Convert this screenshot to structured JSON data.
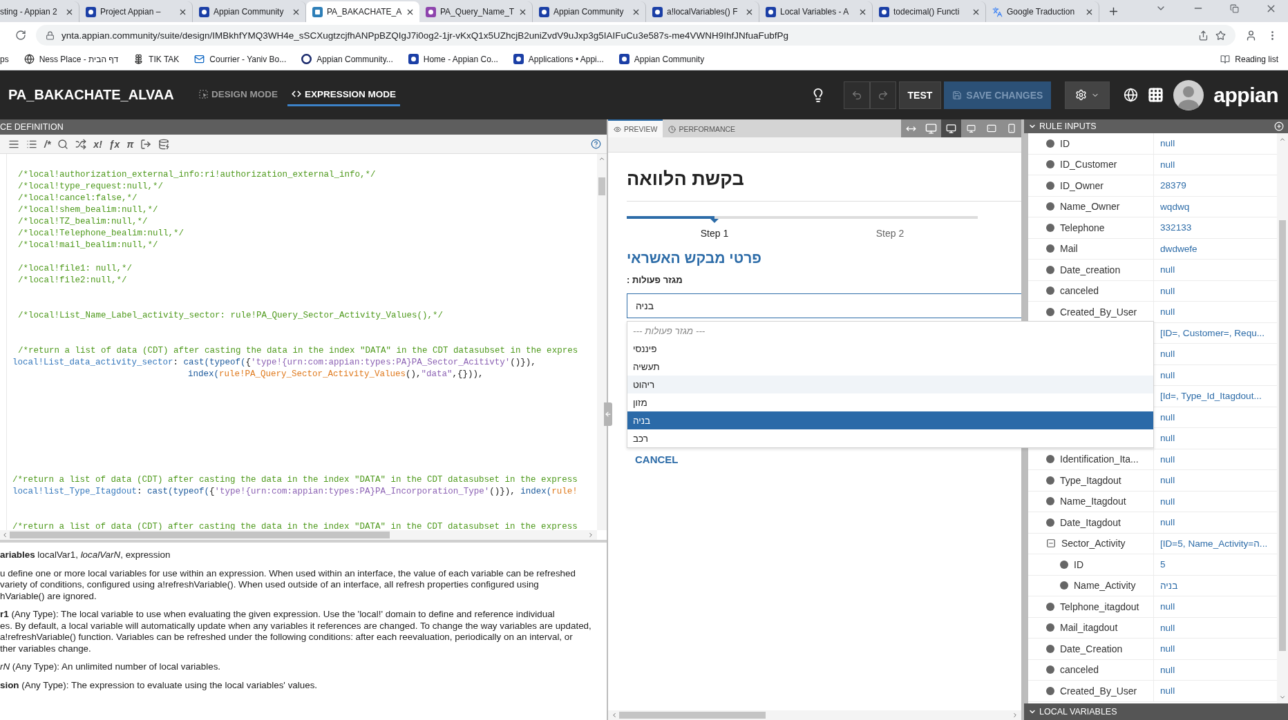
{
  "browser": {
    "tabs": [
      {
        "title": "sting - Appian 2",
        "selected": false
      },
      {
        "title": "Project Appian –",
        "selected": false,
        "kind": "appian"
      },
      {
        "title": "Appian Community",
        "selected": false,
        "kind": "appian"
      },
      {
        "title": "PA_BAKACHATE_A",
        "selected": true,
        "kind": "page"
      },
      {
        "title": "PA_Query_Name_T",
        "selected": false,
        "kind": "query"
      },
      {
        "title": "Appian Community",
        "selected": false,
        "kind": "appian"
      },
      {
        "title": "a!localVariables() F",
        "selected": false,
        "kind": "appian"
      },
      {
        "title": "Local Variables - A",
        "selected": false,
        "kind": "appian"
      },
      {
        "title": "todecimal() Functi",
        "selected": false,
        "kind": "appian"
      },
      {
        "title": "Google Traduction",
        "selected": false,
        "kind": "translate"
      }
    ],
    "url": "ynta.appian.community/suite/design/IMBkhfYMQ3WH4e_sSCXugtzcjfhANPpBZQIgJ7i0og2-1jr-vKxQ1x5UZhcjB2uniZvdV9uJxp3g5IAIFuCu3e587s-me4VWNH9IhfJNfuaFubfPg",
    "bookmarks": [
      {
        "label": "ps"
      },
      {
        "label": "Ness Place - דף הבית",
        "kind": "globe"
      },
      {
        "label": "TIK TAK",
        "kind": "flower"
      },
      {
        "label": "Courrier - Yaniv Bo...",
        "kind": "mail"
      },
      {
        "label": "Appian Community...",
        "kind": "ring"
      },
      {
        "label": "Home - Appian Co...",
        "kind": "appian"
      },
      {
        "label": "Applications • Appi...",
        "kind": "appian"
      },
      {
        "label": "Appian Community",
        "kind": "appian"
      }
    ],
    "reading_list": "Reading list"
  },
  "header": {
    "title": "PA_BAKACHATE_ALVAA",
    "modes": [
      {
        "label": "DESIGN MODE",
        "kind": "design",
        "selected": false
      },
      {
        "label": "EXPRESSION MODE",
        "kind": "expression",
        "selected": true
      }
    ],
    "test": "TEST",
    "save": {
      "label": "SAVE CHANGES",
      "disabled": true
    },
    "logo": "appian"
  },
  "editor": {
    "title": "CE DEFINITION",
    "toolbar": [
      {
        "kind": "indent"
      },
      {
        "kind": "list"
      },
      {
        "kind": "glyph",
        "text": "/*"
      },
      {
        "kind": "search"
      },
      {
        "kind": "shuffle"
      },
      {
        "kind": "glyph",
        "text": "x!"
      },
      {
        "kind": "glyph",
        "text": "ƒx"
      },
      {
        "kind": "glyph",
        "text": "π"
      },
      {
        "kind": "export"
      },
      {
        "kind": "data"
      }
    ],
    "lines": [
      {
        "kind": "comment",
        "tokens": [
          {
            "kind": "comment",
            "t": "/*local!authorization_external_info:ri!authorization_external_info,*/"
          }
        ]
      },
      {
        "kind": "comment",
        "tokens": [
          {
            "kind": "comment",
            "t": "/*local!type_request:null,*/"
          }
        ]
      },
      {
        "kind": "comment",
        "tokens": [
          {
            "kind": "comment",
            "t": "/*local!cancel:false,*/"
          }
        ]
      },
      {
        "kind": "comment",
        "tokens": [
          {
            "kind": "comment",
            "t": "/*local!shem_bealim:null,*/"
          }
        ]
      },
      {
        "kind": "comment",
        "tokens": [
          {
            "kind": "comment",
            "t": "/*local!TZ_bealim:null,*/"
          }
        ]
      },
      {
        "kind": "comment",
        "tokens": [
          {
            "kind": "comment",
            "t": "/*local!Telephone_bealim:null,*/"
          }
        ]
      },
      {
        "kind": "comment",
        "tokens": [
          {
            "kind": "comment",
            "t": "/*local!mail_bealim:null,*/"
          }
        ]
      },
      {
        "kind": "blank"
      },
      {
        "kind": "comment",
        "tokens": [
          {
            "kind": "comment",
            "t": "/*local!file1: null,*/"
          }
        ]
      },
      {
        "kind": "comment",
        "tokens": [
          {
            "kind": "comment",
            "t": "/*local!file2:null,*/"
          }
        ]
      },
      {
        "kind": "blank"
      },
      {
        "kind": "blank"
      },
      {
        "kind": "comment",
        "tokens": [
          {
            "kind": "comment",
            "t": "/*local!List_Name_Label_activity_sector: rule!PA_Query_Sector_Activity_Values(),*/"
          }
        ]
      },
      {
        "kind": "blank"
      },
      {
        "kind": "blank"
      },
      {
        "kind": "comment",
        "tokens": [
          {
            "kind": "comment",
            "t": "/*return a list of data (CDT) after casting the data in the index \"DATA\" in the CDT datasubset in the expres"
          }
        ]
      },
      {
        "kind": "code",
        "tokens": [
          {
            "kind": "var",
            "t": "local!List_data_activity_sector"
          },
          {
            "kind": "punct",
            "t": ":"
          },
          {
            "kind": "func",
            "t": "cast(typeof("
          },
          {
            "kind": "punct",
            "t": "{"
          },
          {
            "kind": "string",
            "t": "'type!{urn:com:appian:types:PA}PA_Sector_Acitivty'"
          },
          {
            "kind": "punct",
            "t": "()}),"
          }
        ]
      },
      {
        "kind": "continuation",
        "tokens": [
          {
            "kind": "func",
            "t": "index("
          },
          {
            "kind": "rule",
            "t": "rule!PA_Query_Sector_Activity_Values"
          },
          {
            "kind": "punct",
            "t": "(),"
          },
          {
            "kind": "string",
            "t": "\"data\""
          },
          {
            "kind": "punct",
            "t": ",{})),"
          }
        ]
      },
      {
        "kind": "blank"
      },
      {
        "kind": "blank"
      },
      {
        "kind": "blank"
      },
      {
        "kind": "blank"
      },
      {
        "kind": "blank"
      },
      {
        "kind": "blank"
      },
      {
        "kind": "blank"
      },
      {
        "kind": "blank"
      },
      {
        "kind": "code",
        "tokens": [
          {
            "kind": "comment",
            "t": "/*return a list of data (CDT) after casting the data in the index \"DATA\" in the CDT datasubset in the express"
          }
        ]
      },
      {
        "kind": "code",
        "tokens": [
          {
            "kind": "var",
            "t": "local!list_Type_Itagdout"
          },
          {
            "kind": "punct",
            "t": ":"
          },
          {
            "kind": "func",
            "t": "cast(typeof("
          },
          {
            "kind": "punct",
            "t": "{"
          },
          {
            "kind": "string",
            "t": "'type!{urn:com:appian:types:PA}PA_Incorporation_Type'"
          },
          {
            "kind": "punct",
            "t": "()}),"
          },
          {
            "kind": "func",
            "t": "index("
          },
          {
            "kind": "rule",
            "t": "rule!"
          }
        ]
      },
      {
        "kind": "blank"
      },
      {
        "kind": "blank"
      },
      {
        "kind": "code",
        "tokens": [
          {
            "kind": "comment",
            "t": "/*return a list of data (CDT) after casting the data in the index \"DATA\" in the CDT datasubset in the express"
          }
        ]
      }
    ]
  },
  "docs": {
    "paragraphs": [
      {
        "lines": [
          "**ariables**  localVar1, *localVarN*, expression"
        ]
      },
      {
        "lines": [
          "u define one or more local variables for use within an expression. When used within an interface, the value of each variable can be refreshed",
          "variety of conditions, configured using a!refreshVariable(). When used outside of an interface, all refresh properties configured using",
          "hVariable() are ignored."
        ]
      },
      {
        "lines": [
          "**r1** (Any Type): The local variable to use when evaluating the given expression. Use the 'local!' domain to define and reference individual",
          "es. By default, a local variable will automatically update when any variables it references are changed. To change the way variables are updated,",
          "a!refreshVariable() function. Variables can be refreshed under the following conditions: after each reevaluation, periodically on an interval, or",
          "ther variables change."
        ]
      },
      {
        "lines": [
          "*rN* (Any Type): An unlimited number of local variables."
        ]
      },
      {
        "lines": [
          "**sion** (Any Type): The expression to evaluate using the local variables' values."
        ]
      }
    ]
  },
  "preview": {
    "tabs": [
      {
        "label": "PREVIEW",
        "kind": "preview",
        "selected": true
      },
      {
        "label": "PERFORMANCE",
        "kind": "performance",
        "selected": false
      }
    ],
    "devices": [
      {
        "kind": "fit",
        "selected": false
      },
      {
        "kind": "wide",
        "selected": false
      },
      {
        "kind": "desktop",
        "selected": true
      },
      {
        "kind": "laptop",
        "selected": false
      },
      {
        "kind": "tablet",
        "selected": false
      },
      {
        "kind": "phone",
        "selected": false
      }
    ],
    "form": {
      "title": "בקשת הלוואה",
      "steps": [
        {
          "label": "Step 1",
          "selected": true
        },
        {
          "label": "Step 2",
          "selected": false
        }
      ],
      "section_title": "פרטי מבקש האשראי",
      "field": {
        "label": "מגזר פעולות :",
        "value": "בניה",
        "expanded": true,
        "options": [
          {
            "label": "--- מגזר פעולות ---",
            "kind": "placeholder",
            "selected": false,
            "hovered": false
          },
          {
            "label": "פיננסי",
            "kind": "option",
            "selected": false,
            "hovered": false
          },
          {
            "label": "תעשיה",
            "kind": "option",
            "selected": false,
            "hovered": false
          },
          {
            "label": "ריהוט",
            "kind": "option",
            "selected": false,
            "hovered": true
          },
          {
            "label": "מזון",
            "kind": "option",
            "selected": false,
            "hovered": false
          },
          {
            "label": "בניה",
            "kind": "option",
            "selected": true,
            "hovered": false
          },
          {
            "label": "רכב",
            "kind": "option",
            "selected": false,
            "hovered": false
          }
        ]
      },
      "cancel": "CANCEL"
    }
  },
  "rule_inputs": {
    "title": "RULE INPUTS",
    "rows": [
      {
        "name": "ID",
        "value": "null"
      },
      {
        "name": "ID_Customer",
        "value": "null"
      },
      {
        "name": "ID_Owner",
        "value": "28379"
      },
      {
        "name": "Name_Owner",
        "value": "wqdwq"
      },
      {
        "name": "Telephone",
        "value": "332133"
      },
      {
        "name": "Mail",
        "value": "dwdwefe"
      },
      {
        "name": "Date_creation",
        "value": "null"
      },
      {
        "name": "canceled",
        "value": "null"
      },
      {
        "name": "Created_By_User",
        "value": "null"
      },
      {
        "value": "[ID=, Customer=, Requ..."
      },
      {
        "value": "null"
      },
      {
        "value": "null"
      },
      {
        "value": "[Id=, Type_Id_Itagdout..."
      },
      {
        "value": "null"
      },
      {
        "value": "null"
      },
      {
        "name": "Identification_Ita...",
        "value": "null"
      },
      {
        "name": "Type_Itagdout",
        "value": "null"
      },
      {
        "name": "Name_Itagdout",
        "value": "null"
      },
      {
        "name": "Date_Itagdout",
        "value": "null"
      },
      {
        "name": "Sector_Activity",
        "value": "[ID=5, Name_Activity=ה...",
        "expanded": true,
        "children": [
          {
            "name": "ID",
            "value": "5"
          },
          {
            "name": "Name_Activity",
            "value": "בניה"
          }
        ]
      },
      {
        "name": "Telphone_itagdout",
        "value": "null"
      },
      {
        "name": "Mail_itagdout",
        "value": "null"
      },
      {
        "name": "Date_Creation",
        "value": "null"
      },
      {
        "name": "canceled",
        "value": "null"
      },
      {
        "name": "Created_By_User",
        "value": "null"
      }
    ]
  },
  "local_variables": {
    "title": "LOCAL VARIABLES"
  }
}
